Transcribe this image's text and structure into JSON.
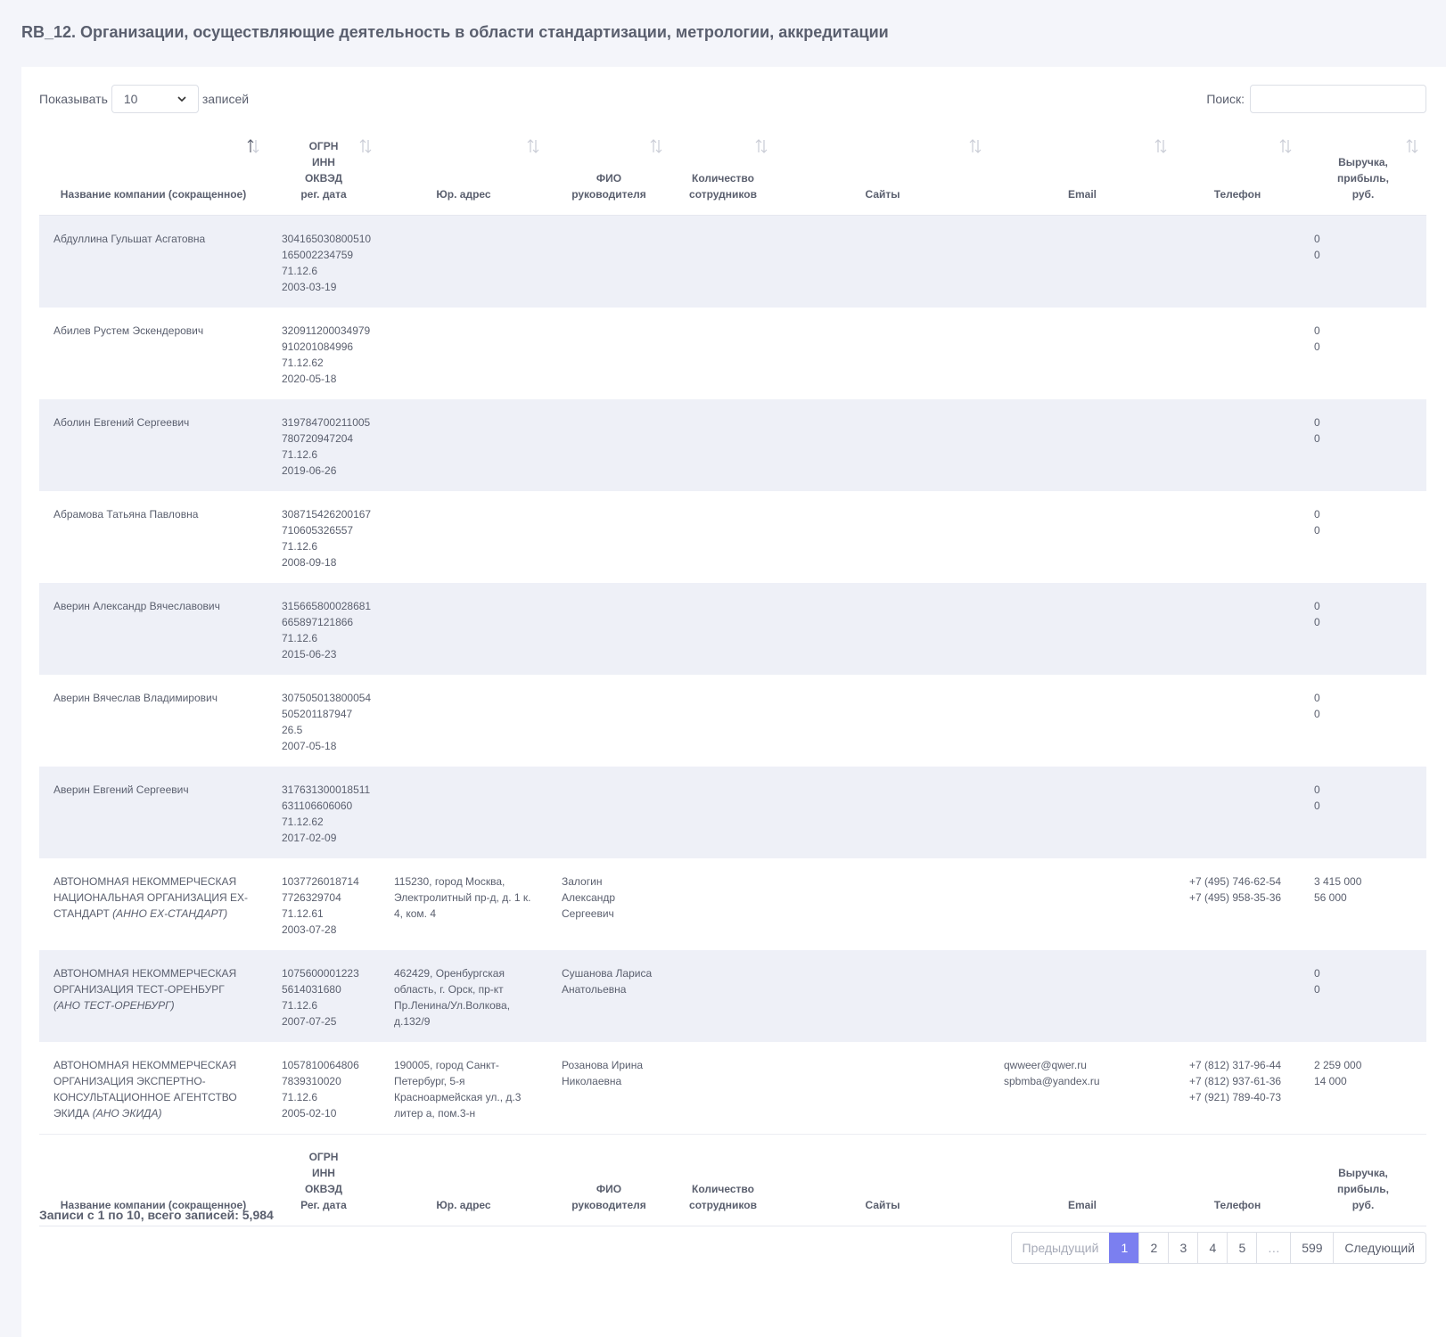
{
  "title": "RB_12. Организации, осуществляющие деятельность в области стандартизации, метрологии, аккредитации",
  "controls": {
    "show_label": "Показывать",
    "page_length": "10",
    "entries_label": "записей",
    "search_label": "Поиск:",
    "search_value": ""
  },
  "columns": {
    "name": "Название компании (сокращенное)",
    "ogrn": [
      "ОГРН",
      "ИНН",
      "ОКВЭД",
      "рег. дата"
    ],
    "address": "Юр. адрес",
    "director": [
      "ФИО",
      "руководителя"
    ],
    "employees": [
      "Количество",
      "сотрудников"
    ],
    "sites": "Сайты",
    "email": "Email",
    "phone": "Телефон",
    "revenue": [
      "Выручка,",
      "прибыль,",
      "руб."
    ]
  },
  "footer_columns": {
    "name": "Название компании (сокращенное)",
    "ogrn": [
      "ОГРН",
      "ИНН",
      "ОКВЭД",
      "Рег. дата"
    ],
    "address": "Юр. адрес",
    "director": [
      "ФИО",
      "руководителя"
    ],
    "employees": [
      "Количество",
      "сотрудников"
    ],
    "sites": "Сайты",
    "email": "Email",
    "phone": "Телефон",
    "revenue": [
      "Выручка,",
      "прибыль,",
      "руб."
    ]
  },
  "rows": [
    {
      "name": "Абдуллина Гульшат Асгатовна",
      "short": "",
      "ogrn": "304165030800510",
      "inn": "165002234759",
      "okved": "71.12.6",
      "reg_date": "2003-03-19",
      "address": "",
      "director": "",
      "employees": "",
      "sites": "",
      "emails": [],
      "phones": [],
      "revenue": "0",
      "profit": "0"
    },
    {
      "name": "Абилев Рустем Эскендерович",
      "short": "",
      "ogrn": "320911200034979",
      "inn": "910201084996",
      "okved": "71.12.62",
      "reg_date": "2020-05-18",
      "address": "",
      "director": "",
      "employees": "",
      "sites": "",
      "emails": [],
      "phones": [],
      "revenue": "0",
      "profit": "0"
    },
    {
      "name": "Аболин Евгений Сергеевич",
      "short": "",
      "ogrn": "319784700211005",
      "inn": "780720947204",
      "okved": "71.12.6",
      "reg_date": "2019-06-26",
      "address": "",
      "director": "",
      "employees": "",
      "sites": "",
      "emails": [],
      "phones": [],
      "revenue": "0",
      "profit": "0"
    },
    {
      "name": "Абрамова Татьяна Павловна",
      "short": "",
      "ogrn": "308715426200167",
      "inn": "710605326557",
      "okved": "71.12.6",
      "reg_date": "2008-09-18",
      "address": "",
      "director": "",
      "employees": "",
      "sites": "",
      "emails": [],
      "phones": [],
      "revenue": "0",
      "profit": "0"
    },
    {
      "name": "Аверин Александр Вячеславович",
      "short": "",
      "ogrn": "315665800028681",
      "inn": "665897121866",
      "okved": "71.12.6",
      "reg_date": "2015-06-23",
      "address": "",
      "director": "",
      "employees": "",
      "sites": "",
      "emails": [],
      "phones": [],
      "revenue": "0",
      "profit": "0"
    },
    {
      "name": "Аверин Вячеслав Владимирович",
      "short": "",
      "ogrn": "307505013800054",
      "inn": "505201187947",
      "okved": "26.5",
      "reg_date": "2007-05-18",
      "address": "",
      "director": "",
      "employees": "",
      "sites": "",
      "emails": [],
      "phones": [],
      "revenue": "0",
      "profit": "0"
    },
    {
      "name": "Аверин Евгений Сергеевич",
      "short": "",
      "ogrn": "317631300018511",
      "inn": "631106606060",
      "okved": "71.12.62",
      "reg_date": "2017-02-09",
      "address": "",
      "director": "",
      "employees": "",
      "sites": "",
      "emails": [],
      "phones": [],
      "revenue": "0",
      "profit": "0"
    },
    {
      "name": "АВТОНОМНАЯ НЕКОММЕРЧЕСКАЯ НАЦИОНАЛЬНАЯ ОРГАНИЗАЦИЯ ЕХ-СТАНДАРТ",
      "short": "(АННО ЕХ-СТАНДАРТ)",
      "ogrn": "1037726018714",
      "inn": "7726329704",
      "okved": "71.12.61",
      "reg_date": "2003-07-28",
      "address": "115230, город Москва, Электролитный пр-д, д. 1 к. 4, ком. 4",
      "director": "Залогин Александр Сергеевич",
      "employees": "",
      "sites": "",
      "emails": [],
      "phones": [
        "+7 (495) 746-62-54",
        "+7 (495) 958-35-36"
      ],
      "revenue": "3 415 000",
      "profit": "56 000"
    },
    {
      "name": "АВТОНОМНАЯ НЕКОММЕРЧЕСКАЯ ОРГАНИЗАЦИЯ ТЕСТ-ОРЕНБУРГ",
      "short": "(АНО ТЕСТ-ОРЕНБУРГ)",
      "ogrn": "1075600001223",
      "inn": "5614031680",
      "okved": "71.12.6",
      "reg_date": "2007-07-25",
      "address": "462429, Оренбургская область, г. Орск, пр-кт Пр.Ленина/Ул.Волкова, д.132/9",
      "director": "Сушанова Лариса Анатольевна",
      "employees": "",
      "sites": "",
      "emails": [],
      "phones": [],
      "revenue": "0",
      "profit": "0"
    },
    {
      "name": "АВТОНОМНАЯ НЕКОММЕРЧЕСКАЯ ОРГАНИЗАЦИЯ ЭКСПЕРТНО-КОНСУЛЬТАЦИОННОЕ АГЕНТСТВО ЭКИДА",
      "short": "(АНО ЭКИДА)",
      "ogrn": "1057810064806",
      "inn": "7839310020",
      "okved": "71.12.6",
      "reg_date": "2005-02-10",
      "address": "190005, город Санкт-Петербург, 5-я Красноармейская ул., д.3 литер а, пом.3-н",
      "director": "Розанова Ирина Николаевна",
      "employees": "",
      "sites": "",
      "emails": [
        "qwweer@qwer.ru",
        "spbmba@yandex.ru"
      ],
      "phones": [
        "+7 (812) 317-96-44",
        "+7 (812) 937-61-36",
        "+7 (921) 789-40-73"
      ],
      "revenue": "2 259 000",
      "profit": "14 000"
    }
  ],
  "info": "Записи с 1 по 10, всего записей: 5,984",
  "pagination": {
    "prev": "Предыдущий",
    "pages": [
      "1",
      "2",
      "3",
      "4",
      "5"
    ],
    "ellipsis": "…",
    "last": "599",
    "next": "Следующий",
    "current": "1"
  }
}
